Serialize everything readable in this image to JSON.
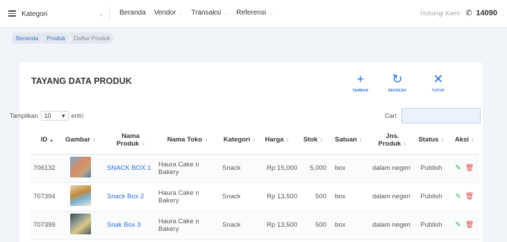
{
  "navbar": {
    "kategori_label": "Kategori",
    "menu": [
      {
        "label": "Beranda",
        "has_dropdown": false
      },
      {
        "label": "Vendor",
        "has_dropdown": true
      },
      {
        "label": "Transaksi",
        "has_dropdown": true
      },
      {
        "label": "Referensi",
        "has_dropdown": true
      }
    ],
    "contact_label": "Hubungi Kami:",
    "contact_number": "14090",
    "icons": {
      "menu": "hamburger-icon",
      "phone": "phone-icon",
      "dropdown": "chevron-down-icon"
    }
  },
  "breadcrumb": [
    "Beranda",
    "Produk",
    "Daftar Produk"
  ],
  "card": {
    "title": "TAYANG DATA PRODUK",
    "actions": [
      {
        "label": "TAMBAH",
        "icon": "plus-icon"
      },
      {
        "label": "REFRESH",
        "icon": "refresh-icon"
      },
      {
        "label": "TUTUP",
        "icon": "close-icon"
      }
    ]
  },
  "table_controls": {
    "show_label": "Tampilkan",
    "entries_value": "10",
    "entries_suffix": "entri",
    "search_label": "Cari:",
    "search_value": ""
  },
  "table": {
    "headers": [
      "ID",
      "Gambar",
      "Nama Produk",
      "Nama Toko",
      "Kategori",
      "Harga",
      "Stok",
      "Satuan",
      "Jns. Produk",
      "Status",
      "Aksi"
    ],
    "rows": [
      {
        "id": "706132",
        "name": "SNACK BOX 1",
        "toko": "Haura Cake n Bakery",
        "kategori": "Snack",
        "harga": "Rp 15,000",
        "stok": "5,000",
        "satuan": "box",
        "jenis": "dalam negeri",
        "status": "Publish"
      },
      {
        "id": "707394",
        "name": "Snack Box 2",
        "toko": "Haura Cake n Bakery",
        "kategori": "Snack",
        "harga": "Rp 13,500",
        "stok": "500",
        "satuan": "box",
        "jenis": "dalam negeri",
        "status": "Publish"
      },
      {
        "id": "707399",
        "name": "Snak Box 3",
        "toko": "Haura Cake n Bakery",
        "kategori": "Snack",
        "harga": "Rp 13,500",
        "stok": "500",
        "satuan": "box",
        "jenis": "dalam negeri",
        "status": "Publish"
      }
    ]
  },
  "colors": {
    "accent": "#2f6fd6",
    "edit": "#3ab54a",
    "delete": "#e34a4a",
    "page_bg": "#f1f4f8"
  }
}
